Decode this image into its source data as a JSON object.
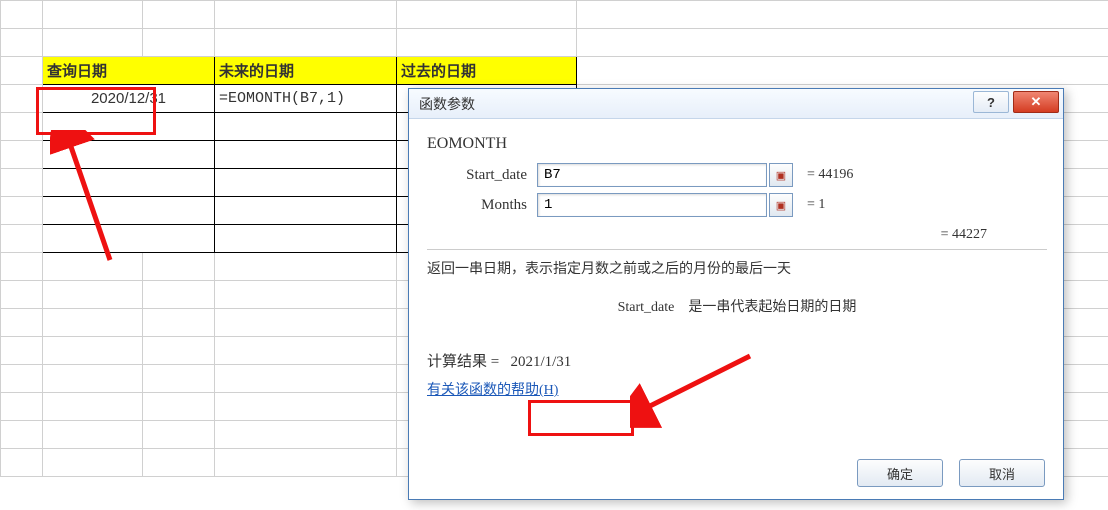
{
  "sheet": {
    "headers": [
      "查询日期",
      "未来的日期",
      "过去的日期"
    ],
    "row1": {
      "date": "2020/12/31",
      "formula": "=EOMONTH(B7,1)"
    }
  },
  "dialog": {
    "title": "函数参数",
    "help_icon": "?",
    "close_icon": "✕",
    "fn_name": "EOMONTH",
    "args": [
      {
        "label": "Start_date",
        "value": "B7",
        "result": "= 44196"
      },
      {
        "label": "Months",
        "value": "1",
        "result": "= 1"
      }
    ],
    "intermediate": "= 44227",
    "description": "返回一串日期，表示指定月数之前或之后的月份的最后一天",
    "arg_desc_label": "Start_date",
    "arg_desc_text": "是一串代表起始日期的日期",
    "result_label": "计算结果 =",
    "result_value": "2021/1/31",
    "help_link": "有关该函数的帮助(H)",
    "ok": "确定",
    "cancel": "取消"
  }
}
